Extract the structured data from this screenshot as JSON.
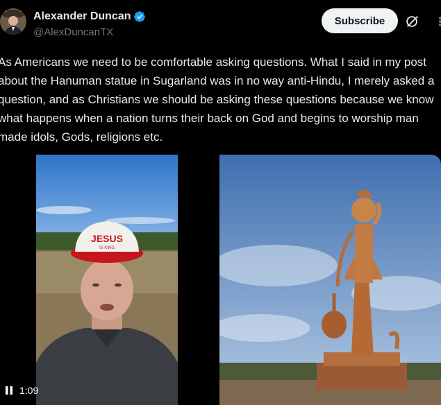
{
  "user": {
    "display_name": "Alexander Duncan",
    "handle": "@AlexDuncanTX",
    "verified": true
  },
  "actions": {
    "subscribe_label": "Subscribe",
    "icons": [
      "grok-icon",
      "more-icon"
    ]
  },
  "post": {
    "text": "As Americans we need to be comfortable asking questions. What I said in my post about the Hanuman statue in Sugarland was in no way anti-Hindu, I merely asked a question, and as Christians we should be asking these questions because we know what happens when a nation turns their back on God and begins to worship man made idols, Gods, religions etc."
  },
  "media": {
    "video": {
      "time": "1:09",
      "hat_text": "JESUS",
      "hat_subtext": "IS KING"
    },
    "image": {
      "subject": "hanuman-statue"
    }
  },
  "colors": {
    "background": "#000000",
    "text": "#e7e9ea",
    "muted": "#71767b",
    "verified": "#1d9bf0",
    "button_bg": "#eff3f4"
  }
}
